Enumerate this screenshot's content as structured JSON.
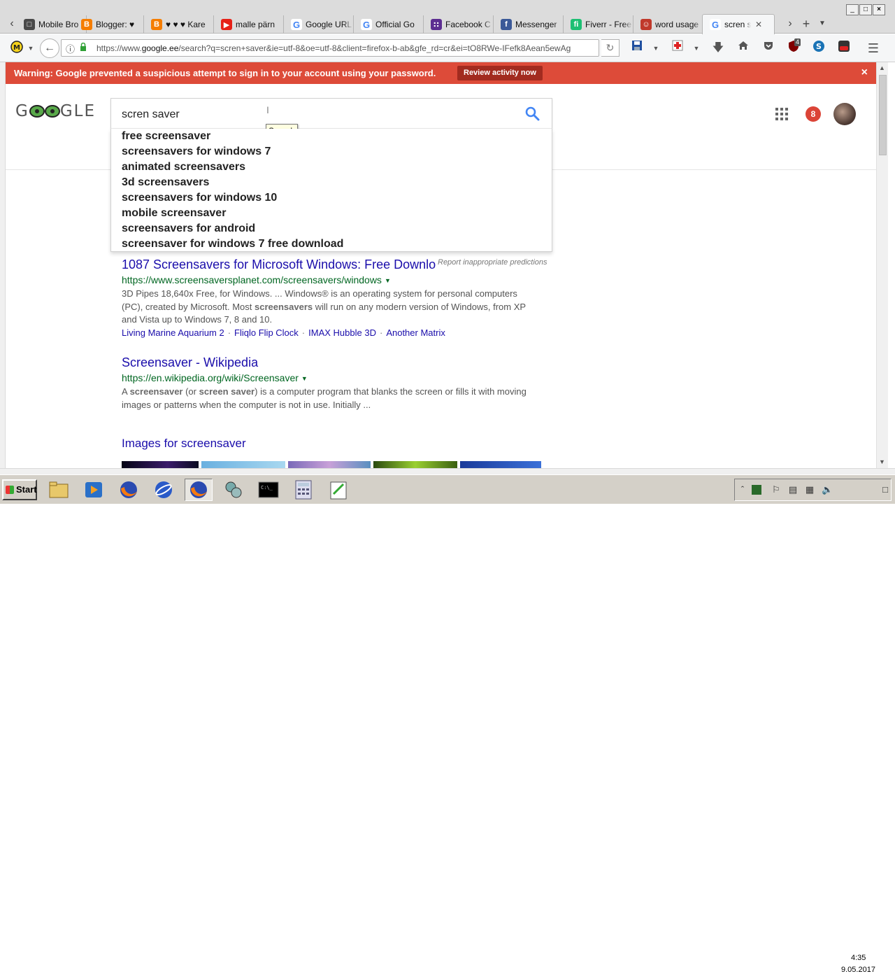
{
  "browser": {
    "tabs": [
      {
        "label": "Mobile Bro",
        "icon": "mobile-icon",
        "color": "#4a4a4a"
      },
      {
        "label": "Blogger: ♥",
        "icon": "blogger-icon",
        "color": "#f57d00"
      },
      {
        "label": "♥ ♥ ♥ Kare",
        "icon": "blogger-icon",
        "color": "#f57d00"
      },
      {
        "label": "malle pärn",
        "icon": "youtube-icon",
        "color": "#e62117"
      },
      {
        "label": "Google URL",
        "icon": "google-icon",
        "color": "#4285f4"
      },
      {
        "label": "Official Go",
        "icon": "google-icon",
        "color": "#4285f4"
      },
      {
        "label": "Facebook C",
        "icon": "dots-icon",
        "color": "#5c2d91"
      },
      {
        "label": "Messenger",
        "icon": "facebook-icon",
        "color": "#3b5998"
      },
      {
        "label": "Fiverr - Free",
        "icon": "fiverr-icon",
        "color": "#1dbf73"
      },
      {
        "label": "word usage",
        "icon": "word-icon",
        "color": "#c0392b"
      },
      {
        "label": "scren sa",
        "icon": "google-icon",
        "color": "#4285f4"
      }
    ],
    "url": {
      "prefix": "https://www.",
      "domain": "google.ee",
      "rest": "/search?q=scren+saver&ie=utf-8&oe=utf-8&client=firefox-b-ab&gfe_rd=cr&ei=tO8RWe-IFefk8Aean5ewAg"
    },
    "addon_badge": "4"
  },
  "warning": {
    "message": "Warning: Google prevented a suspicious attempt to sign in to your account using your password.",
    "button": "Review activity now",
    "close": "×"
  },
  "google": {
    "logo": {
      "letters_before": "G",
      "letters_after": "GLE"
    },
    "query": "scren saver",
    "tooltip": "Search",
    "suggestions": [
      "free screensaver",
      "screensavers for windows 7",
      "animated screensavers",
      "3d screensavers",
      "screensavers for windows 10",
      "mobile screensaver",
      "screensavers for android",
      "screensaver for windows 7 free download"
    ],
    "report": "Report inappropriate predictions",
    "notifications": "8",
    "results": [
      {
        "title": "1087 Screensavers for Microsoft Windows: Free Downlo",
        "url": "https://www.screensaversplanet.com/screensavers/windows",
        "snippet_1": "3D Pipes 18,640x Free, for Windows. ... Windows® is an operating system for personal computers (PC), created by Microsoft. Most ",
        "snippet_bold": "screensavers",
        "snippet_2": " will run on any modern version of Windows, from XP and Vista up to Windows 7, 8 and 10.",
        "sitelinks": [
          "Living Marine Aquarium 2",
          "Fliqlo Flip Clock",
          "IMAX Hubble 3D",
          "Another Matrix"
        ],
        "sitelink_sep": "·"
      },
      {
        "title": "Screensaver - Wikipedia",
        "url": "https://en.wikipedia.org/wiki/Screensaver",
        "snippet_a": "A ",
        "snippet_b1": "screensaver",
        "snippet_c": " (or ",
        "snippet_b2": "screen saver",
        "snippet_d": ") is a computer program that blanks the screen or fills it with moving images or patterns when the computer is not in use. Initially ..."
      }
    ],
    "images_heading": "Images for screensaver"
  },
  "taskbar": {
    "start": "Start",
    "time": "4:35",
    "date": "9.05.2017"
  }
}
